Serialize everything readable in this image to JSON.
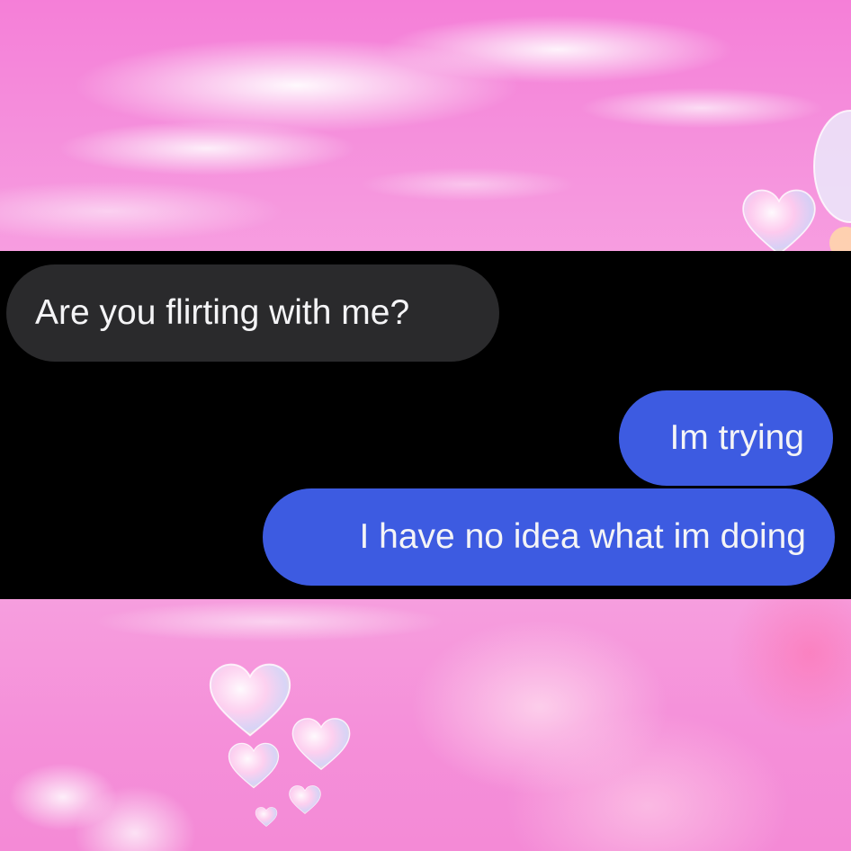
{
  "conversation": {
    "messages": [
      {
        "sender": "other",
        "text": "Are you flirting with me?"
      },
      {
        "sender": "me",
        "text": "Im trying"
      },
      {
        "sender": "me",
        "text": "I have no idea what im doing"
      }
    ]
  },
  "background": {
    "sky_color": "#f58fd9",
    "cloud_color": "#ffffff",
    "chat_background": "#000000",
    "incoming_bubble_color": "#2a2a2c",
    "outgoing_bubble_color": "#3d5be1",
    "decorations": [
      "bubble-heart-icon"
    ]
  }
}
